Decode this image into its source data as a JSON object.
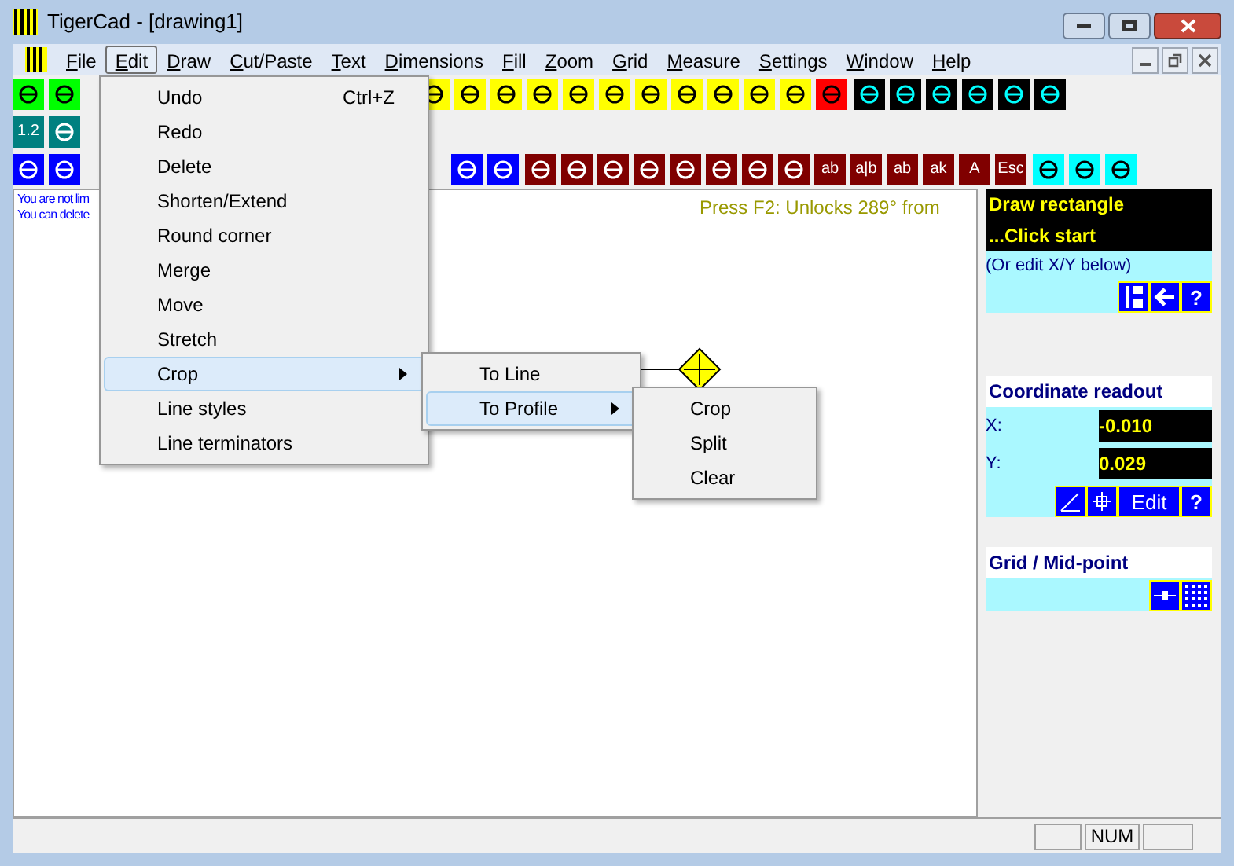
{
  "window": {
    "title": "TigerCad - [drawing1]"
  },
  "menu_bar": [
    {
      "label": "File",
      "selected": false
    },
    {
      "label": "Edit",
      "selected": true
    },
    {
      "label": "Draw",
      "selected": false
    },
    {
      "label": "Cut/Paste",
      "selected": false
    },
    {
      "label": "Text",
      "selected": false
    },
    {
      "label": "Dimensions",
      "selected": false
    },
    {
      "label": "Fill",
      "selected": false
    },
    {
      "label": "Zoom",
      "selected": false
    },
    {
      "label": "Grid",
      "selected": false
    },
    {
      "label": "Measure",
      "selected": false
    },
    {
      "label": "Settings",
      "selected": false
    },
    {
      "label": "Window",
      "selected": false
    },
    {
      "label": "Help",
      "selected": false
    }
  ],
  "toolbars": [
    {
      "groups": [
        [
          {
            "color": "#00ff00"
          },
          {
            "color": "#00ff00"
          }
        ],
        [
          {
            "color": "#ffff00"
          },
          {
            "color": "#ffff00"
          },
          {
            "color": "#ffff00"
          },
          {
            "color": "#ffff00"
          },
          {
            "color": "#ffff00"
          },
          {
            "color": "#ffff00"
          },
          {
            "color": "#ffff00"
          },
          {
            "color": "#ffff00"
          },
          {
            "color": "#ffff00"
          },
          {
            "color": "#ffff00"
          },
          {
            "color": "#ffff00"
          },
          {
            "color": "#ff0000"
          }
        ],
        [
          {
            "color": "#000000"
          },
          {
            "color": "#000000"
          },
          {
            "color": "#000000"
          },
          {
            "color": "#000000"
          },
          {
            "color": "#000000"
          },
          {
            "color": "#000000"
          }
        ]
      ]
    },
    {
      "groups": [
        [
          {
            "color": "#008080",
            "label": "1.2"
          },
          {
            "color": "#008080"
          }
        ]
      ]
    },
    {
      "groups": [
        [
          {
            "color": "#0000ff"
          },
          {
            "color": "#0000ff"
          }
        ],
        [
          {
            "color": "#0000ff"
          },
          {
            "color": "#0000ff"
          }
        ],
        [
          {
            "color": "#800000"
          },
          {
            "color": "#800000"
          },
          {
            "color": "#800000"
          },
          {
            "color": "#800000"
          },
          {
            "color": "#800000"
          },
          {
            "color": "#800000"
          },
          {
            "color": "#800000"
          },
          {
            "color": "#800000"
          },
          {
            "color": "#800000",
            "label": "ab"
          },
          {
            "color": "#800000",
            "label": "a|b"
          },
          {
            "color": "#800000",
            "label": "ab"
          },
          {
            "color": "#800000",
            "label": "ak"
          },
          {
            "color": "#800000",
            "label": "A"
          },
          {
            "color": "#800000",
            "label": "Esc"
          }
        ],
        [
          {
            "color": "#00ffff"
          },
          {
            "color": "#00ffff"
          },
          {
            "color": "#00ffff"
          }
        ]
      ]
    }
  ],
  "canvas": {
    "hints": [
      "You are not lim",
      "You can delete"
    ],
    "status_hint": "Press F2: Unlocks 289° from"
  },
  "edit_menu": [
    {
      "label": "Undo",
      "shortcut": "Ctrl+Z",
      "submenu": false,
      "selected": false
    },
    {
      "label": "Redo",
      "submenu": false,
      "selected": false
    },
    {
      "label": "Delete",
      "submenu": false,
      "selected": false
    },
    {
      "label": "Shorten/Extend",
      "submenu": false,
      "selected": false
    },
    {
      "label": "Round corner",
      "submenu": false,
      "selected": false
    },
    {
      "label": "Merge",
      "submenu": false,
      "selected": false
    },
    {
      "label": "Move",
      "submenu": false,
      "selected": false
    },
    {
      "label": "Stretch",
      "submenu": false,
      "selected": false
    },
    {
      "label": "Crop",
      "submenu": true,
      "selected": true
    },
    {
      "label": "Line styles",
      "submenu": false,
      "selected": false
    },
    {
      "label": "Line terminators",
      "submenu": false,
      "selected": false
    }
  ],
  "crop_menu": [
    {
      "label": "To Line",
      "submenu": false,
      "selected": false
    },
    {
      "label": "To Profile",
      "submenu": true,
      "selected": true
    }
  ],
  "profile_menu": [
    {
      "label": "Crop",
      "submenu": false,
      "selected": false
    },
    {
      "label": "Split",
      "submenu": false,
      "selected": false
    },
    {
      "label": "Clear",
      "submenu": false,
      "selected": false
    }
  ],
  "prompt": {
    "title": "Draw rectangle",
    "subtitle": "...Click start",
    "hint": "(Or edit X/Y below)",
    "help": "?"
  },
  "coordinate_readout": {
    "title": "Coordinate readout",
    "x_label": "X:",
    "x_value": "-0.010",
    "y_label": "Y:",
    "y_value": "0.029",
    "edit": "Edit",
    "help": "?"
  },
  "grid": {
    "title": "Grid / Mid-point"
  },
  "status_bar": {
    "indicator": "NUM"
  }
}
